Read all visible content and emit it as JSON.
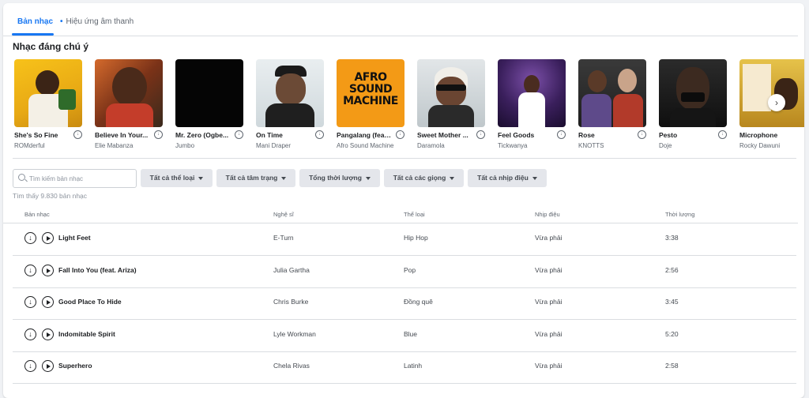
{
  "tabs": [
    {
      "label": "Bản nhạc",
      "active": true
    },
    {
      "label": "Hiệu ứng âm thanh",
      "dot": "•"
    }
  ],
  "featured": {
    "title": "Nhạc đáng chú ý",
    "items": [
      {
        "title": "She's So Fine",
        "artist": "ROMderful"
      },
      {
        "title": "Believe In Your...",
        "artist": "Elie Mabanza"
      },
      {
        "title": "Mr. Zero (Ogbe...",
        "artist": "Jumbo"
      },
      {
        "title": "On Time",
        "artist": "Mani Draper"
      },
      {
        "title": "Pangalang (feat....",
        "artist": "Afro Sound Machine",
        "cover_text": "AFRO SOUND MACHINE"
      },
      {
        "title": "Sweet Mother ...",
        "artist": "Daramola"
      },
      {
        "title": "Feel Goods",
        "artist": "Tickwanya"
      },
      {
        "title": "Rose",
        "artist": "KNOTTS"
      },
      {
        "title": "Pesto",
        "artist": "Doje"
      },
      {
        "title": "Microphone",
        "artist": "Rocky Dawuni"
      }
    ]
  },
  "search": {
    "placeholder": "Tìm kiếm bản nhạc",
    "value": ""
  },
  "filters": [
    "Tất cả thể loại",
    "Tất cả tâm trạng",
    "Tổng thời lượng",
    "Tất cả các giọng",
    "Tất cả nhịp điệu"
  ],
  "result_count": "Tìm thấy 9.830 bản nhạc",
  "table": {
    "headers": [
      "Bản nhạc",
      "Nghệ sĩ",
      "Thể loại",
      "Nhịp điệu",
      "Thời lượng"
    ],
    "rows": [
      {
        "title": "Light Feet",
        "artist": "E-Turn",
        "genre": "Hip Hop",
        "tempo": "Vừa phải",
        "duration": "3:38"
      },
      {
        "title": "Fall Into You (feat. Ariza)",
        "artist": "Julia Gartha",
        "genre": "Pop",
        "tempo": "Vừa phải",
        "duration": "2:56"
      },
      {
        "title": "Good Place To Hide",
        "artist": "Chris Burke",
        "genre": "Đồng quê",
        "tempo": "Vừa phải",
        "duration": "3:45"
      },
      {
        "title": "Indomitable Spirit",
        "artist": "Lyle Workman",
        "genre": "Blue",
        "tempo": "Vừa phải",
        "duration": "5:20"
      },
      {
        "title": "Superhero",
        "artist": "Chela Rivas",
        "genre": "Latinh",
        "tempo": "Vừa phải",
        "duration": "2:58"
      }
    ]
  },
  "colors": {
    "accent": "#1877f2",
    "page_bg": "#f0f2f5",
    "filter_bg": "#e4e6eb"
  }
}
